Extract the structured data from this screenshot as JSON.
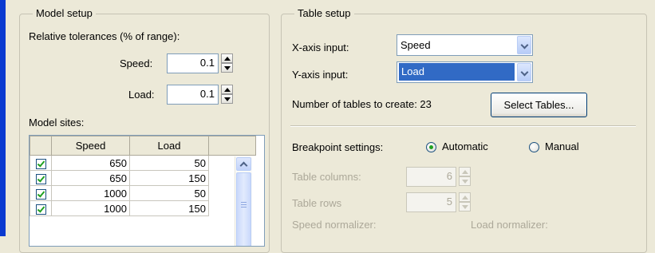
{
  "model_setup": {
    "title": "Model setup",
    "tolerances_label": "Relative tolerances (% of range):",
    "speed_label": "Speed:",
    "speed_value": "0.1",
    "load_label": "Load:",
    "load_value": "0.1",
    "sites_label": "Model sites:",
    "sites_columns": [
      "Speed",
      "Load"
    ],
    "sites_rows": [
      {
        "checked": true,
        "speed": "650",
        "load": "50"
      },
      {
        "checked": true,
        "speed": "650",
        "load": "150"
      },
      {
        "checked": true,
        "speed": "1000",
        "load": "50"
      },
      {
        "checked": true,
        "speed": "1000",
        "load": "150"
      }
    ]
  },
  "table_setup": {
    "title": "Table setup",
    "x_axis_label": "X-axis input:",
    "x_axis_value": "Speed",
    "y_axis_label": "Y-axis input:",
    "y_axis_value": "Load",
    "num_tables_text": "Number of tables to create: 23",
    "select_tables_label": "Select Tables...",
    "breakpoint_label": "Breakpoint settings:",
    "automatic_label": "Automatic",
    "manual_label": "Manual",
    "breakpoint_mode": "Automatic",
    "table_columns_label": "Table columns:",
    "table_columns_value": "6",
    "table_rows_label": "Table rows",
    "table_rows_value": "5",
    "speed_normalizer_label": "Speed normalizer:",
    "load_normalizer_label": "Load normalizer:"
  },
  "colors": {
    "background": "#ece9d8",
    "accent_blue": "#0a3ad0",
    "selection": "#316ac5",
    "check_green": "#21a121"
  }
}
